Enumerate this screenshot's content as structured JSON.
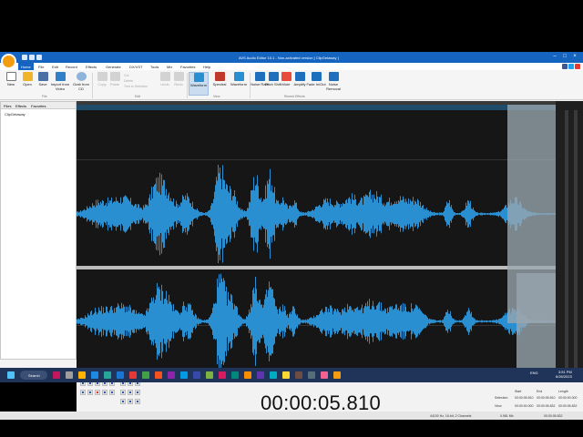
{
  "window": {
    "title": "AVS Audio Editor 10.1 - Non-activated version [ ClipGetaway ]",
    "colors": {
      "accent": "#1565c0",
      "wave": "#2a8fd1",
      "wave_bg": "#161616",
      "selection": "#9aa6b0"
    }
  },
  "menu": {
    "items": [
      "Home",
      "File",
      "Edit",
      "Record",
      "Effects",
      "Generate",
      "DX/VST",
      "Tools",
      "Mix",
      "Favorites",
      "Help"
    ]
  },
  "ribbon": {
    "buttons": [
      {
        "label": "New",
        "icon": "new-file-icon"
      },
      {
        "label": "Open",
        "icon": "open-folder-icon"
      },
      {
        "label": "Save",
        "icon": "save-icon"
      },
      {
        "label": "Import from Video",
        "icon": "import-video-icon"
      },
      {
        "label": "Grab from CD",
        "icon": "cd-icon"
      },
      {
        "label": "Copy",
        "icon": "copy-icon"
      },
      {
        "label": "Paste",
        "icon": "paste-icon"
      },
      {
        "label": "Undo",
        "icon": "undo-icon"
      },
      {
        "label": "Redo",
        "icon": "redo-icon"
      },
      {
        "label": "Waveform",
        "icon": "waveform-icon"
      },
      {
        "label": "Spectral",
        "icon": "spectral-icon"
      },
      {
        "label": "Waveform",
        "icon": "waveform-icon"
      },
      {
        "label": "Noise Rate",
        "icon": "noise-icon"
      },
      {
        "label": "Pitch Shift",
        "icon": "pitch-icon"
      },
      {
        "label": "Mute",
        "icon": "mute-icon"
      },
      {
        "label": "Amplify",
        "icon": "amplify-icon"
      },
      {
        "label": "Fade In/Out",
        "icon": "fade-icon"
      },
      {
        "label": "Noise Removal",
        "icon": "noise-removal-icon"
      }
    ],
    "small_items": [
      "Cut",
      "Delete",
      "Trim to Selection"
    ],
    "groups": [
      "File",
      "Edit",
      "View",
      "Recent Effects"
    ]
  },
  "sidepanel": {
    "tabs": [
      "Files",
      "Effects",
      "Favorites"
    ],
    "file": "ClipGetaway"
  },
  "transport": {
    "timecode": "00:00:05.810",
    "table": {
      "headers": [
        "Start",
        "End",
        "Length"
      ],
      "rows": [
        {
          "label": "Selection",
          "values": [
            "00:00:05.810",
            "00:00:05.810",
            "00:00:00.000"
          ]
        },
        {
          "label": "View",
          "values": [
            "00:00:00.000",
            "00:00:05.832",
            "00:00:05.832"
          ]
        }
      ]
    }
  },
  "status": {
    "format": "44100 Hz, 16-bit, 2 Channels",
    "size": "0.981 Mb",
    "duration": "00:00:05.832"
  },
  "taskbar": {
    "search": "Search",
    "tray": "ENG",
    "time": "3:51 PM",
    "date": "6/26/2023"
  }
}
